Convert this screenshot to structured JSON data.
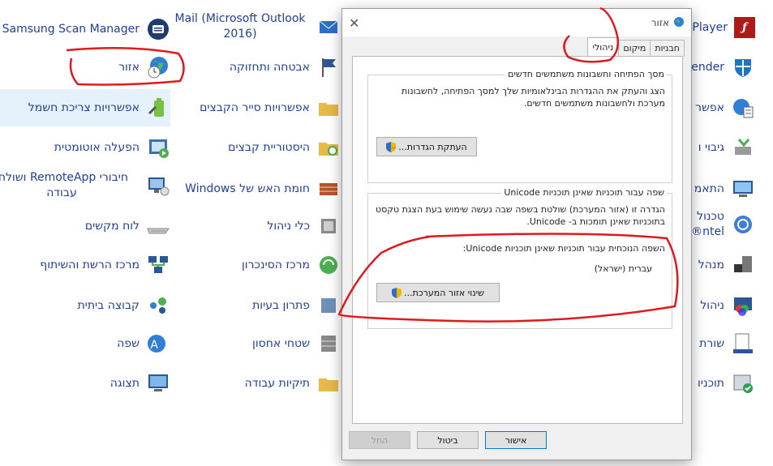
{
  "right_column": {
    "items": [
      {
        "label": "Samsung Scan Manager",
        "icon": "scanner-icon"
      },
      {
        "label": "אזור",
        "icon": "globe-clock-icon"
      },
      {
        "label": "אפשרויות צריכת חשמל",
        "icon": "power-options-icon"
      },
      {
        "label": "הפעלה אוטומטית",
        "icon": "autoplay-icon"
      },
      {
        "label": "חיבורי RemoteApp ושולחן עבודה",
        "icon": "remoteapp-icon"
      },
      {
        "label": "לוח מקשים",
        "icon": "keyboard-icon"
      },
      {
        "label": "מרכז הרשת והשיתוף",
        "icon": "network-icon"
      },
      {
        "label": "קבוצה ביתית",
        "icon": "homegroup-icon"
      },
      {
        "label": "שפה",
        "icon": "language-icon"
      },
      {
        "label": "תצוגה",
        "icon": "display-icon"
      }
    ]
  },
  "middle_column": {
    "items": [
      {
        "label": "Mail (Microsoft Outlook 2016)",
        "icon": "mail-icon"
      },
      {
        "label": "אבטחה ותחזוקה",
        "icon": "flag-icon"
      },
      {
        "label": "אפשרויות סייר הקבצים",
        "icon": "folder-options-icon"
      },
      {
        "label": "היסטוריית קבצים",
        "icon": "file-history-icon"
      },
      {
        "label": "חומת האש של Windows",
        "icon": "firewall-icon"
      },
      {
        "label": "כלי ניהול",
        "icon": "admin-tools-icon"
      },
      {
        "label": "מרכז הסינכרון",
        "icon": "sync-icon"
      },
      {
        "label": "פתרון בעיות",
        "icon": "troubleshoot-icon"
      },
      {
        "label": "שטחי אחסון",
        "icon": "storage-icon"
      },
      {
        "label": "תיקיות עבודה",
        "icon": "work-folders-icon"
      }
    ]
  },
  "left_column": {
    "items": [
      {
        "label": "Player",
        "icon": "flash-icon"
      },
      {
        "label": "ender",
        "icon": "defender-icon"
      },
      {
        "label": "אפשר",
        "icon": "internet-options-icon"
      },
      {
        "label": "גיבוי ו",
        "icon": "backup-icon"
      },
      {
        "label": "התאמ",
        "icon": "personalize-icon"
      },
      {
        "label": "טכנול ntel®",
        "icon": "intel-icon"
      },
      {
        "label": "מנהל",
        "icon": "device-manager-icon"
      },
      {
        "label": "ניהול",
        "icon": "color-management-icon"
      },
      {
        "label": "שורת",
        "icon": "taskbar-icon"
      },
      {
        "label": "תוכניו",
        "icon": "programs-icon"
      }
    ]
  },
  "dialog": {
    "title": "אזור",
    "close_glyph": "✕",
    "tabs": [
      "חבניות",
      "מיקום",
      "ניהולי"
    ],
    "active_tab": "ניהולי",
    "welcome_group": {
      "title": "מסך הפתיחה וחשבונות משתמשים חדשים",
      "description": "הצג והעתק את ההגדרות הבינלאומיות שלך למסך הפתיחה, לחשבונות מערכת ולחשבונות משתמשים חדשים.",
      "button": "העתקת הגדרות..."
    },
    "unicode_group": {
      "title": "שפה עבור תוכניות שאינן תוכניות Unicode",
      "description": "הגדרה זו (אזור המערכת) שולטת בשפה שבה נעשה שימוש בעת הצגת טקסט בתוכניות שאינן תומכות ב- Unicode.",
      "current_label": "השפה הנוכחית עבור תוכניות שאינן תוכניות Unicode:",
      "current_value": "עברית (ישראל)",
      "button": "שינוי אזור המערכת..."
    },
    "ok_label": "אישור",
    "cancel_label": "ביטול",
    "apply_label": "החל"
  },
  "colors": {
    "annotation_red": "#e0191d",
    "link_blue": "#1f3f99",
    "selection": "#e5f1fb"
  }
}
